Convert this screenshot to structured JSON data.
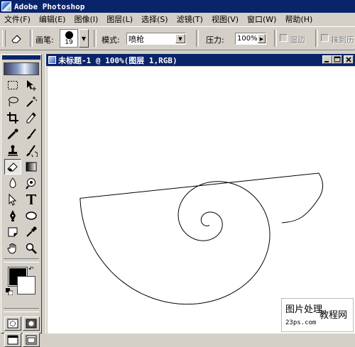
{
  "app": {
    "title": "Adobe Photoshop"
  },
  "menu": [
    "文件(F)",
    "编辑(E)",
    "图像(I)",
    "图层(L)",
    "选择(S)",
    "滤镜(T)",
    "视图(V)",
    "窗口(W)",
    "帮助(H)"
  ],
  "options": {
    "brush_label": "画笔:",
    "brush_size": "19",
    "mode_label": "模式:",
    "mode_value": "喷枪",
    "pressure_label": "压力:",
    "pressure_value": "100%",
    "wet_edges_label": "湿边",
    "erase_to_history_label": "抹到历"
  },
  "document": {
    "title": "未标题-1 @ 100%(图层 1,RGB)"
  },
  "watermark": {
    "line1": "图片处理",
    "line2": "教程网",
    "line3": "23ps.com"
  },
  "colors": {
    "titlebar": "#0a246a",
    "chrome": "#d4d0c8",
    "foreground": "#000000",
    "background": "#ffffff"
  },
  "tools": [
    "marquee-tool",
    "move-tool",
    "lasso-tool",
    "magic-wand-tool",
    "crop-tool",
    "slice-tool",
    "healing-brush-tool",
    "brush-tool",
    "clone-stamp-tool",
    "history-brush-tool",
    "eraser-tool",
    "gradient-tool",
    "blur-tool",
    "dodge-tool",
    "path-selection-tool",
    "type-tool",
    "pen-tool",
    "ellipse-tool",
    "notes-tool",
    "eyedropper-tool",
    "hand-tool",
    "zoom-tool"
  ]
}
